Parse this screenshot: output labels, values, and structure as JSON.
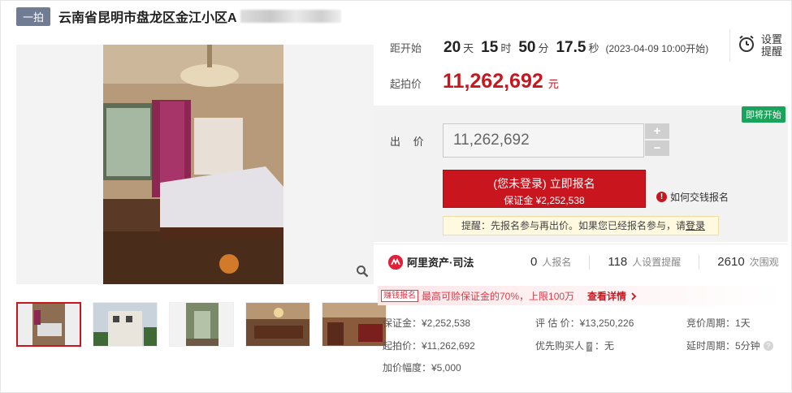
{
  "header": {
    "tag": "一拍",
    "title": "云南省昆明市盘龙区金江小区A"
  },
  "countdown": {
    "label": "距开始",
    "days": "20",
    "days_unit": "天",
    "hours": "15",
    "hours_unit": "时",
    "minutes": "50",
    "minutes_unit": "分",
    "seconds": "17.5",
    "seconds_unit": "秒",
    "start_time": "(2023-04-09 10:00开始)"
  },
  "remind": {
    "label": "设置提醒"
  },
  "start_price": {
    "label": "起拍价",
    "value": "11,262,692",
    "unit": "元"
  },
  "bid": {
    "status_badge": "即将开始",
    "label": "出 价",
    "placeholder": "11,262,692",
    "plus": "+",
    "minus": "−",
    "signup_line1": "(您未登录) 立即报名",
    "signup_line2": "保证金 ¥2,252,538",
    "how_pay": "如何交钱报名",
    "tip_prefix": "提醒：先报名参与再出价。如果您已经报名参与，请",
    "tip_login": "登录"
  },
  "stats": {
    "brand": "阿里资产·司法",
    "signup_count": "0",
    "signup_unit": "人报名",
    "reminder_count": "118",
    "reminder_unit": "人设置提醒",
    "view_count": "2610",
    "view_unit": "次围观"
  },
  "promo": {
    "tag": "赚钱报名",
    "text": "最高可赊保证金的70%，上限100万",
    "link": "查看详情"
  },
  "info": {
    "deposit": "保证金：¥2,252,538",
    "appraisal": "评 估 价：¥13,250,226",
    "cycle": "竞价周期：1天",
    "start_price": "起拍价：¥11,262,692",
    "priority_prefix": "优先购买人",
    "priority_badge": "?",
    "priority_value": "：无",
    "delay": "延时周期：5分钟",
    "increment": "加价幅度：¥5,000"
  },
  "icons": {
    "zoom": "magnifier-icon",
    "remind": "alarm-clock-icon",
    "how_pay": "info-icon",
    "brand": "alibaba-logo-icon",
    "promo_arrow": "chevron-right-icon"
  },
  "colors": {
    "accent": "#c9151e",
    "tag": "#6f7c93",
    "status_green": "#1aa45b",
    "promo": "#e23a48"
  }
}
